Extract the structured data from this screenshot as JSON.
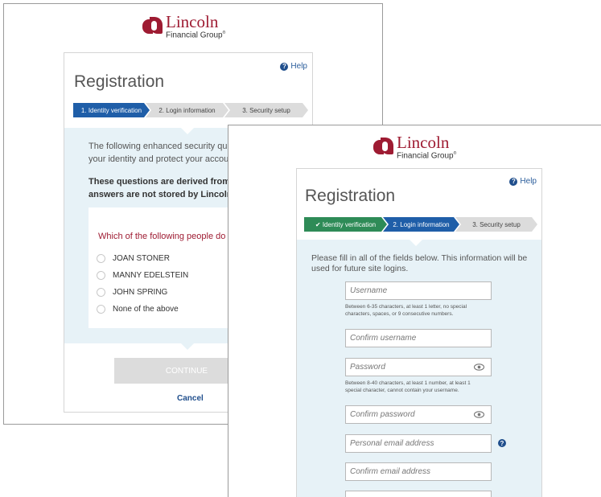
{
  "brand": {
    "name": "Lincoln",
    "sub": "Financial Group",
    "reg": "®"
  },
  "back": {
    "help": "Help",
    "title": "Registration",
    "steps": [
      "1. Identity verification",
      "2. Login information",
      "3. Security setup"
    ],
    "intro": [
      "The following enhanced security questions",
      "your identity and protect your account."
    ],
    "bold": [
      "These questions are derived from public r",
      "answers are not stored by Lincoln Financi"
    ],
    "question": "Which of the following people do you k",
    "options": [
      "JOAN STONER",
      "MANNY EDELSTEIN",
      "JOHN SPRING",
      "None of the above"
    ],
    "continue": "CONTINUE",
    "cancel": "Cancel"
  },
  "front": {
    "help": "Help",
    "title": "Registration",
    "steps": [
      "✔ Identity verification",
      "2. Login information",
      "3. Security setup"
    ],
    "intro": [
      "Please fill in all of the fields below. This information will be",
      "used for future site logins."
    ],
    "fields": {
      "username": "Username",
      "username_hint": [
        "Between 6-35 characters, at least 1 letter, no special",
        "characters, spaces, or 9 consecutive numbers."
      ],
      "confirm_username": "Confirm username",
      "password": "Password",
      "password_hint": [
        "Between 8-40 characters, at least 1 number, at least 1",
        "special character, cannot contain your username."
      ],
      "confirm_password": "Confirm password",
      "email": "Personal email address",
      "confirm_email": "Confirm email address"
    }
  },
  "colors": {
    "brand": "#9e1b32",
    "active_step": "#1f5ea8",
    "done_step": "#2e8b57",
    "shade": "#e7f2f7"
  }
}
